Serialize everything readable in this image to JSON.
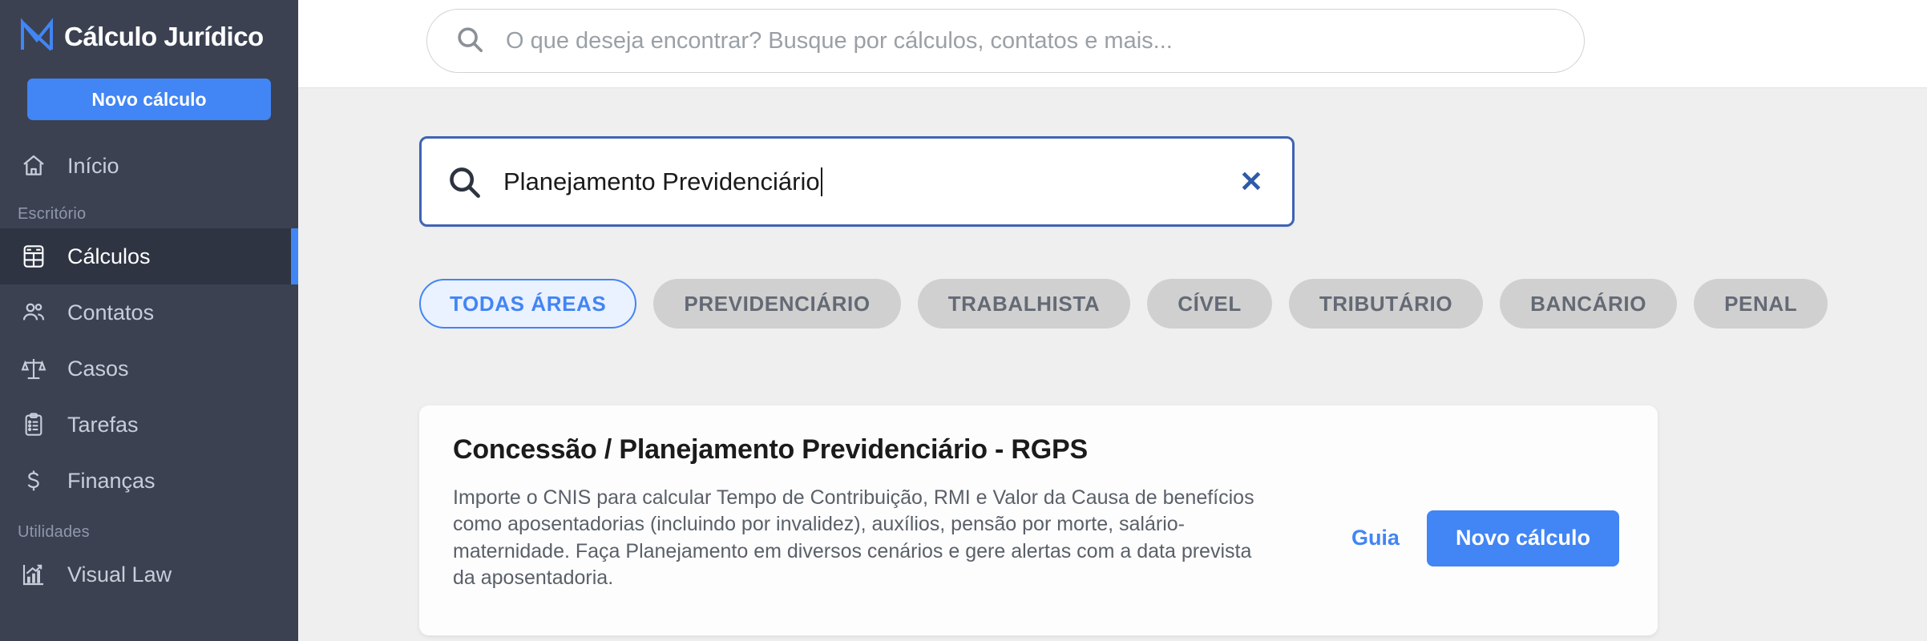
{
  "sidebar": {
    "brand": {
      "name": "Cálculo Jurídico",
      "logo_icon": "m-logo-icon"
    },
    "new_calc_label": "Novo cálculo",
    "items": [
      {
        "label": "Início",
        "icon": "home-icon",
        "active": false
      },
      {
        "label": "Cálculos",
        "icon": "calculator-icon",
        "active": true
      },
      {
        "label": "Contatos",
        "icon": "people-icon",
        "active": false
      },
      {
        "label": "Casos",
        "icon": "scales-icon",
        "active": false
      },
      {
        "label": "Tarefas",
        "icon": "clipboard-icon",
        "active": false
      },
      {
        "label": "Finanças",
        "icon": "dollar-icon",
        "active": false
      },
      {
        "label": "Visual Law",
        "icon": "chart-growth-icon",
        "active": false
      }
    ],
    "sections": {
      "escritorio": "Escritório",
      "utilidades": "Utilidades"
    }
  },
  "topbar": {
    "global_search_placeholder": "O que deseja encontrar? Busque por cálculos, contatos e mais...",
    "search_icon": "search-icon"
  },
  "content": {
    "ghost_heading": "Planejamento Previdenciário",
    "search": {
      "value": "Planejamento Previdenciário",
      "icon": "search-icon",
      "clear_icon": "close-icon",
      "clear_glyph": "✕"
    },
    "filters": [
      {
        "label": "TODAS ÁREAS",
        "active": true
      },
      {
        "label": "PREVIDENCIÁRIO",
        "active": false
      },
      {
        "label": "TRABALHISTA",
        "active": false
      },
      {
        "label": "CÍVEL",
        "active": false
      },
      {
        "label": "TRIBUTÁRIO",
        "active": false
      },
      {
        "label": "BANCÁRIO",
        "active": false
      },
      {
        "label": "PENAL",
        "active": false
      }
    ],
    "result_card": {
      "title": "Concessão / Planejamento Previdenciário - RGPS",
      "description": "Importe o CNIS para calcular Tempo de Contribuição, RMI e Valor da Causa de benefícios como aposentadorias (incluindo por invalidez), auxílios, pensão por morte, salário-maternidade. Faça Planejamento em diversos cenários e gere alertas com a data prevista da aposentadoria.",
      "guide_label": "Guia",
      "primary_label": "Novo cálculo"
    }
  },
  "colors": {
    "sidebar_bg": "#3b4151",
    "sidebar_active_bg": "#2e3442",
    "accent": "#4285f4",
    "page_bg": "#efefef",
    "card_bg": "#fdfdfd",
    "pill_bg": "#d0d0d0",
    "search_border": "#3f63b5"
  }
}
